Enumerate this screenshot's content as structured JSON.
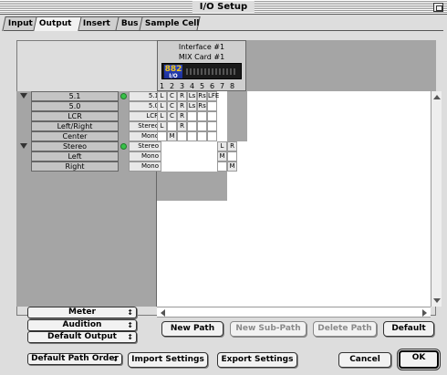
{
  "window": {
    "title": "I/O Setup"
  },
  "tabs": [
    {
      "label": "Input"
    },
    {
      "label": "Output"
    },
    {
      "label": "Insert"
    },
    {
      "label": "Bus"
    },
    {
      "label": "Sample Cell"
    }
  ],
  "active_tab": "Output",
  "hardware": {
    "interface_name": "Interface #1",
    "card_name": "MIX Card #1",
    "device_label_big": "882",
    "device_label_small": "I/O",
    "channels": [
      "1",
      "2",
      "3",
      "4",
      "5",
      "6",
      "7",
      "8"
    ]
  },
  "paths": [
    {
      "name": "5.1",
      "format": "5.1",
      "expandable": true,
      "active": true,
      "assign": [
        "L",
        "C",
        "R",
        "Ls",
        "Rs",
        "LFE",
        "",
        ""
      ]
    },
    {
      "name": "5.0",
      "format": "5.0",
      "expandable": false,
      "active": false,
      "assign": [
        "L",
        "C",
        "R",
        "Ls",
        "Rs",
        "",
        "",
        ""
      ]
    },
    {
      "name": "LCR",
      "format": "LCR",
      "expandable": false,
      "active": false,
      "assign": [
        "L",
        "C",
        "R",
        "",
        "",
        "",
        "",
        ""
      ]
    },
    {
      "name": "Left/Right",
      "format": "Stereo",
      "expandable": false,
      "active": false,
      "assign": [
        "L",
        "",
        "R",
        "",
        "",
        "",
        "",
        ""
      ]
    },
    {
      "name": "Center",
      "format": "Mono",
      "expandable": false,
      "active": false,
      "assign": [
        "",
        "M",
        "",
        "",
        "",
        "",
        "",
        ""
      ]
    },
    {
      "name": "Stereo",
      "format": "Stereo",
      "expandable": true,
      "active": true,
      "assign": [
        "",
        "",
        "",
        "",
        "",
        "",
        "L",
        "R"
      ]
    },
    {
      "name": "Left",
      "format": "Mono",
      "expandable": false,
      "active": false,
      "assign": [
        "",
        "",
        "",
        "",
        "",
        "",
        "M",
        ""
      ]
    },
    {
      "name": "Right",
      "format": "Mono",
      "expandable": false,
      "active": false,
      "assign": [
        "",
        "",
        "",
        "",
        "",
        "",
        "",
        "M"
      ]
    }
  ],
  "popups": {
    "meter": "Meter",
    "audition": "Audition",
    "default_output": "Default Output",
    "default_path_order": "Default Path Order"
  },
  "buttons": {
    "new_path": "New Path",
    "new_sub_path": "New Sub-Path",
    "delete_path": "Delete Path",
    "default": "Default",
    "import_settings": "Import Settings",
    "export_settings": "Export Settings",
    "cancel": "Cancel",
    "ok": "OK"
  },
  "button_states": {
    "new_sub_path_enabled": false,
    "delete_path_enabled": false
  },
  "icons": {
    "zoom": "zoom-box-icon",
    "expand": "disclosure-triangle-icon",
    "active": "path-active-icon",
    "popup": "popup-arrows-icon"
  }
}
